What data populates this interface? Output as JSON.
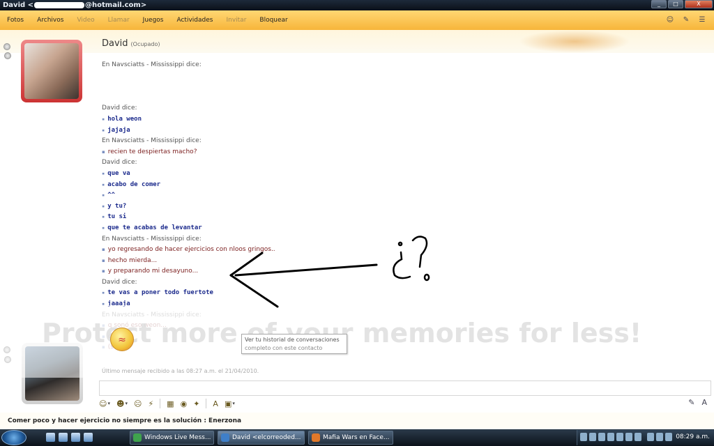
{
  "window": {
    "title_prefix": "David <",
    "title_suffix": "@hotmail.com>",
    "buttons": [
      "_",
      "□",
      "X"
    ]
  },
  "menu": [
    {
      "label": "Fotos",
      "enabled": true
    },
    {
      "label": "Archivos",
      "enabled": true
    },
    {
      "label": "Video",
      "enabled": false
    },
    {
      "label": "Llamar",
      "enabled": false
    },
    {
      "label": "Juegos",
      "enabled": true
    },
    {
      "label": "Actividades",
      "enabled": true
    },
    {
      "label": "Invitar",
      "enabled": false
    },
    {
      "label": "Bloquear",
      "enabled": true
    }
  ],
  "contact": {
    "name": "David",
    "status": "(Ocupado)"
  },
  "conversation": [
    {
      "type": "speaker",
      "text": "En Navsciatts - Mississippi dice:"
    },
    {
      "type": "blank",
      "text": ""
    },
    {
      "type": "blank",
      "text": ""
    },
    {
      "type": "blank",
      "text": ""
    },
    {
      "type": "speaker",
      "text": "David dice:"
    },
    {
      "type": "msg",
      "who": "david",
      "text": "hola weon"
    },
    {
      "type": "msg",
      "who": "david",
      "text": "jajaja"
    },
    {
      "type": "speaker",
      "text": "En Navsciatts - Mississippi dice:"
    },
    {
      "type": "msg",
      "who": "nav",
      "text": "recien te despiertas macho?"
    },
    {
      "type": "speaker",
      "text": "David dice:"
    },
    {
      "type": "msg",
      "who": "david",
      "text": "que va"
    },
    {
      "type": "msg",
      "who": "david",
      "text": "acabo de comer"
    },
    {
      "type": "msg",
      "who": "david",
      "text": "^^"
    },
    {
      "type": "msg",
      "who": "david",
      "text": "y tu?"
    },
    {
      "type": "msg",
      "who": "david",
      "text": "tu si"
    },
    {
      "type": "msg",
      "who": "david",
      "text": "que te acabas de levantar"
    },
    {
      "type": "speaker",
      "text": "En Navsciatts - Mississippi dice:"
    },
    {
      "type": "msg",
      "who": "nav",
      "text": "yo regresando de hacer ejercicios con nloos gringos.."
    },
    {
      "type": "msg",
      "who": "nav",
      "text": "hecho mierda..."
    },
    {
      "type": "msg",
      "who": "nav",
      "text": "y preparando mi desayuno..."
    },
    {
      "type": "speaker",
      "text": "David dice:"
    },
    {
      "type": "msg",
      "who": "david",
      "text": "te vas a poner todo fuertote"
    },
    {
      "type": "msg",
      "who": "david",
      "text": "jaaaja"
    },
    {
      "type": "speaker",
      "faded": true,
      "text": "En Navsciatts - Mississippi dice:"
    },
    {
      "type": "msg",
      "who": "nav",
      "faded": true,
      "text": "q sonó eso weon..."
    },
    {
      "type": "msg",
      "who": "nav",
      "faded": true,
      "text": "clik!"
    },
    {
      "type": "msg",
      "who": "nav",
      "faded": true,
      "text": "(ss)"
    }
  ],
  "overlay_text": "Protect more of your memories for less!",
  "tooltip": {
    "line1": "Ver tu historial de conversaciones",
    "line2": "completo con este contacto"
  },
  "last_message": "Último mensaje recibido a las 08:27 a.m. el 21/04/2010.",
  "annotation": "¿?",
  "status_line": "Comer poco y hacer ejercicio no siempre es la solución : Enerzona",
  "taskbar": {
    "tasks": [
      {
        "label": "Windows Live Mess...",
        "active": false,
        "color": "#3fa34d"
      },
      {
        "label": "David <elcorreoded...",
        "active": true,
        "color": "#3f7fc8"
      },
      {
        "label": "Mafia Wars en Face...",
        "active": false,
        "color": "#e0782a"
      }
    ],
    "clock": "08:29 a.m."
  }
}
